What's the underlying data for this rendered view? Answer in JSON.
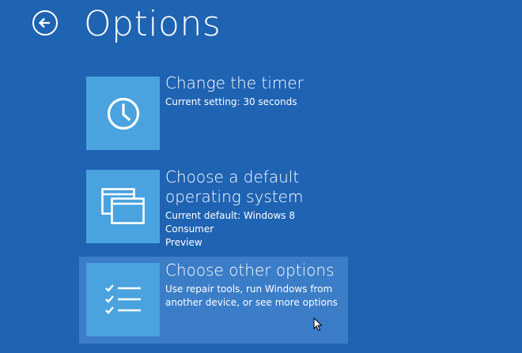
{
  "header": {
    "title": "Options",
    "back_icon": "arrow-left-icon"
  },
  "options": [
    {
      "icon": "clock-icon",
      "title": "Change the timer",
      "description": "Current setting: 30 seconds"
    },
    {
      "icon": "windows-icon",
      "title_line1": "Choose a default",
      "title_line2": "operating system",
      "description_line1": "Current default: Windows 8 Consumer",
      "description_line2": "Preview"
    },
    {
      "icon": "checklist-icon",
      "title": "Choose other options",
      "description_line1": "Use repair tools, run Windows from",
      "description_line2": "another device, or see more options"
    }
  ],
  "colors": {
    "background": "#1f63b3",
    "tile": "#4aa3df",
    "highlight": "#3b7dc7"
  }
}
